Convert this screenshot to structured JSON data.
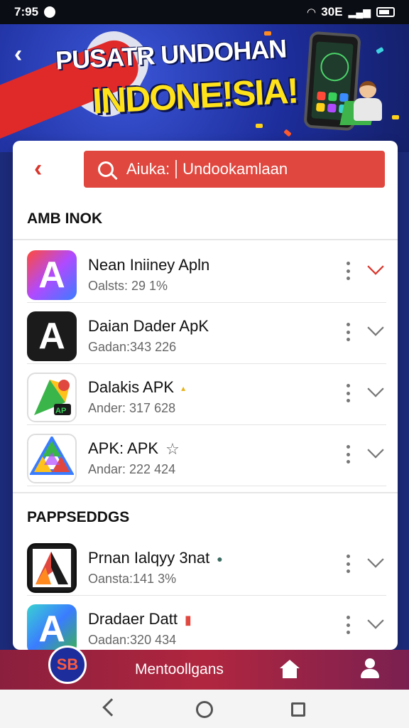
{
  "status_bar": {
    "time": "7:95",
    "network": "30E"
  },
  "banner": {
    "title_line1": "PUSATR UNDOHAN",
    "title_line2": "INDONE!SIA!"
  },
  "search": {
    "text_left": "Aiuka:",
    "text_right": "Undookamlaan"
  },
  "sections": [
    {
      "title": "AMB INOK",
      "apps": [
        {
          "name": "Nean Iniiney Apln",
          "meta": "Oalsts: 29 1%",
          "badge": ""
        },
        {
          "name": "Daian Dader ApK",
          "meta": "Gadan:343 226",
          "badge": ""
        },
        {
          "name": "Dalakis APK",
          "meta": "Ander: 317 628",
          "badge": "▴"
        },
        {
          "name": "APK: APK",
          "meta": "Andar: 222 424",
          "badge": "☆"
        }
      ]
    },
    {
      "title": "PAPPSEDDGS",
      "apps": [
        {
          "name": "Prnan Ialqyy 3nat",
          "meta": "Oansta:141 3%",
          "badge": "●"
        },
        {
          "name": "Dradaer Datt",
          "meta": "Oadan:320 434",
          "badge": "▮"
        }
      ]
    }
  ],
  "bottom_bar": {
    "avatar_text": "SB",
    "label": "Mentoollgans"
  },
  "colors": {
    "accent": "#e0473e",
    "bottom_bar": "#b1263f",
    "banner": "#1d2d9b"
  },
  "icons": {
    "top_back": "chevron-left-icon",
    "card_back": "chevron-left-icon",
    "search": "search-icon",
    "home": "home-icon",
    "profile": "profile-icon"
  }
}
